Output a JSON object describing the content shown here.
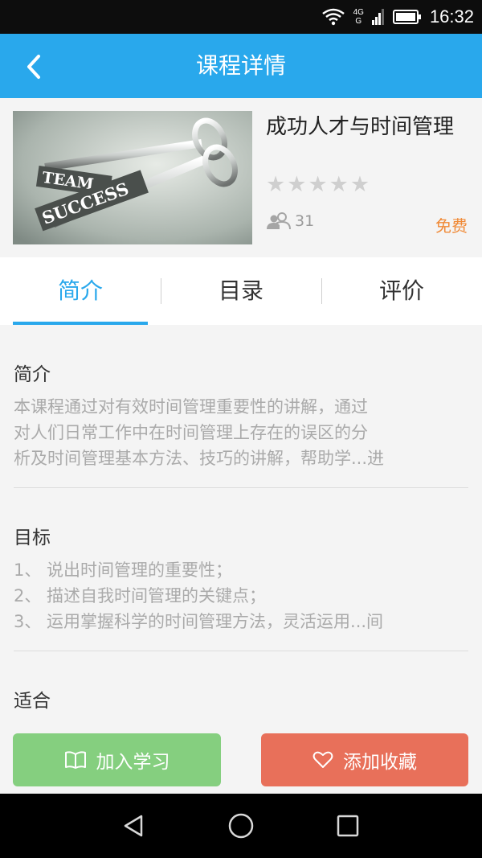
{
  "status_bar": {
    "time": "16:32",
    "network": "4G",
    "network_sub": "G",
    "icons": [
      "wifi-icon",
      "signal-icon",
      "battery-icon"
    ]
  },
  "titlebar": {
    "title": "课程详情",
    "back_icon": "chevron-left-icon"
  },
  "course": {
    "name": "成功人才与时间管理",
    "thumbnail_words": [
      "TEAM",
      "SUCCESS"
    ],
    "rating": 0,
    "rating_max": 5,
    "learners": "31",
    "price": "免费"
  },
  "tabs": [
    {
      "label": "简介",
      "active": true
    },
    {
      "label": "目录",
      "active": false
    },
    {
      "label": "评价",
      "active": false
    }
  ],
  "sections": {
    "intro": {
      "title": "简介",
      "lines": [
        "本课程通过对有效时间管理重要性的讲解，通过",
        "对人们日常工作中在时间管理上存在的误区的分",
        "析及时间管理基本方法、技巧的讲解，帮助学...进"
      ]
    },
    "goals": {
      "title": "目标",
      "lines": [
        "1、 说出时间管理的重要性；",
        "2、 描述自我时间管理的关键点；",
        "3、 运用掌握科学的时间管理方法，灵活运用...间"
      ]
    },
    "audience": {
      "title": "适合"
    }
  },
  "actions": {
    "join_label": "加入学习",
    "favorite_label": "添加收藏"
  },
  "colors": {
    "primary": "#29a8ec",
    "join": "#85cf7f",
    "favorite": "#e8705a",
    "price": "#f08a37"
  }
}
